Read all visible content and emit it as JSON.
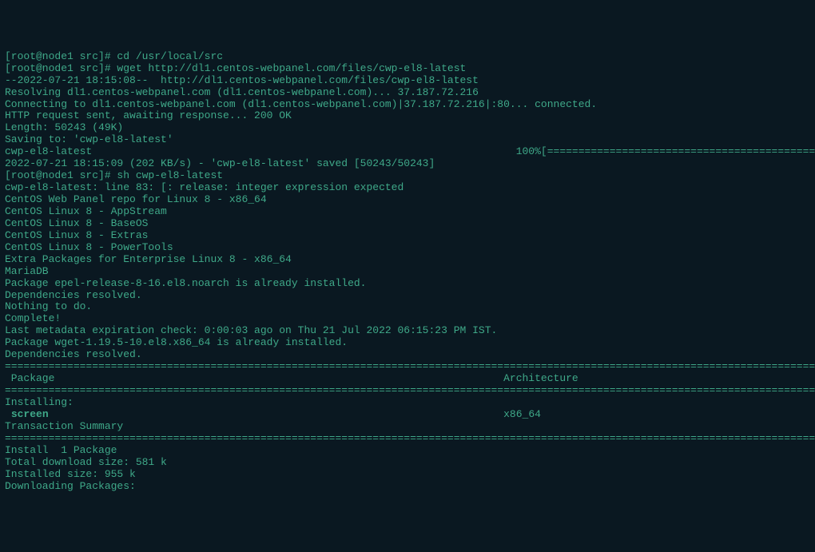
{
  "lines": [
    "[root@node1 src]# cd /usr/local/src",
    "[root@node1 src]# wget http://dl1.centos-webpanel.com/files/cwp-el8-latest",
    "--2022-07-21 18:15:08--  http://dl1.centos-webpanel.com/files/cwp-el8-latest",
    "Resolving dl1.centos-webpanel.com (dl1.centos-webpanel.com)... 37.187.72.216",
    "Connecting to dl1.centos-webpanel.com (dl1.centos-webpanel.com)|37.187.72.216|:80... connected.",
    "HTTP request sent, awaiting response... 200 OK",
    "Length: 50243 (49K)",
    "Saving to: 'cwp-el8-latest'",
    "",
    "cwp-el8-latest                                                                    100%[==================================================",
    "",
    "2022-07-21 18:15:09 (202 KB/s) - 'cwp-el8-latest' saved [50243/50243]",
    "",
    "[root@node1 src]# sh cwp-el8-latest",
    "cwp-el8-latest: line 83: [: release: integer expression expected",
    "CentOS Web Panel repo for Linux 8 - x86_64",
    "CentOS Linux 8 - AppStream",
    "CentOS Linux 8 - BaseOS",
    "CentOS Linux 8 - Extras",
    "CentOS Linux 8 - PowerTools",
    "Extra Packages for Enterprise Linux 8 - x86_64",
    "MariaDB",
    "Package epel-release-8-16.el8.noarch is already installed.",
    "Dependencies resolved.",
    "Nothing to do.",
    "Complete!",
    "Last metadata expiration check: 0:00:03 ago on Thu 21 Jul 2022 06:15:23 PM IST.",
    "Package wget-1.19.5-10.el8.x86_64 is already installed.",
    "Dependencies resolved.",
    "=======================================================================================================================================",
    " Package                                                                        Architecture",
    "=======================================================================================================================================",
    "Installing:",
    " screen                                                                         x86_64",
    "",
    "Transaction Summary",
    "=======================================================================================================================================",
    "Install  1 Package",
    "",
    "Total download size: 581 k",
    "Installed size: 955 k",
    "Downloading Packages:"
  ],
  "highlight_indices": [
    33
  ]
}
